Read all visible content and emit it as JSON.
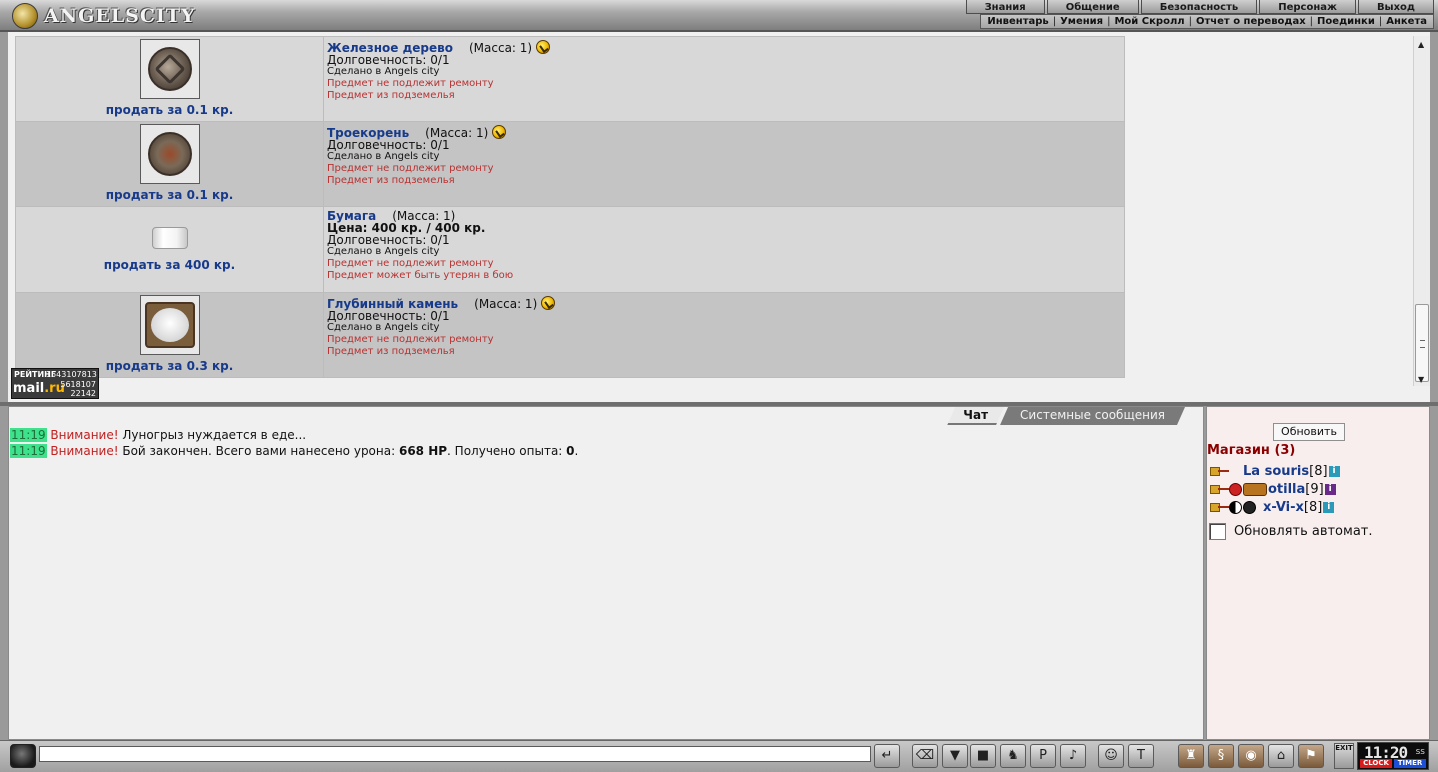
{
  "logo": {
    "text": "ANGELSCITY"
  },
  "top_nav": [
    "Знания",
    "Общение",
    "Безопасность",
    "Персонаж",
    "Выход"
  ],
  "sub_nav": [
    "Инвентарь",
    "Умения",
    "Мой Скролл",
    "Отчет о переводах",
    "Поединки",
    "Анкета"
  ],
  "items": [
    {
      "name": "Железное дерево",
      "mass": "(Масса: 1)",
      "gift": true,
      "sell": "продать за 0.1 кр.",
      "price": "",
      "durability": "Долговечность: 0/1",
      "made": "Сделано в Angels city",
      "red1": "Предмет не подлежит ремонту",
      "red2": "Предмет из подземелья",
      "image": "rune-disk-icon"
    },
    {
      "name": "Троекорень",
      "mass": "(Масса: 1)",
      "gift": true,
      "sell": "продать за 0.1 кр.",
      "price": "",
      "durability": "Долговечность: 0/1",
      "made": "Сделано в Angels city",
      "red1": "Предмет не подлежит ремонту",
      "red2": "Предмет из подземелья",
      "image": "spiral-disk-icon"
    },
    {
      "name": "Бумага",
      "mass": "(Масса: 1)",
      "gift": false,
      "sell": "продать за 400 кр.",
      "price": "Цена: 400 кр. / 400 кр.",
      "durability": "Долговечность: 0/1",
      "made": "Сделано в Angels city",
      "red1": "Предмет не подлежит ремонту",
      "red2": "Предмет может быть утерян в бою",
      "image": "paper-scroll-icon"
    },
    {
      "name": "Глубинный камень",
      "mass": "(Масса: 1)",
      "gift": true,
      "sell": "продать за 0.3 кр.",
      "price": "",
      "durability": "Долговечность: 0/1",
      "made": "Сделано в Angels city",
      "red1": "Предмет не подлежит ремонту",
      "red2": "Предмет из подземелья",
      "image": "deep-stone-icon"
    }
  ],
  "rating": {
    "label": "РЕЙТИНГ",
    "n1": "1543107813",
    "mail": "mail",
    "ru": ".ru",
    "n2": "5618107",
    "n3": "22142"
  },
  "chat": {
    "tabs": [
      "Чат",
      "Системные сообщения"
    ],
    "active_tab": "Чат",
    "messages": [
      {
        "time": "11:19",
        "warn": "Внимание!",
        "text": " Луногрыз нуждается в еде..."
      },
      {
        "time": "11:19",
        "warn": "Внимание!",
        "text_a": " Бой закончен. Всего вами нанесено урона: ",
        "bold_a": "668 HP",
        "text_b": ". Получено опыта: ",
        "bold_b": "0",
        "text_c": "."
      }
    ]
  },
  "side": {
    "refresh_label": "Обновить",
    "shop_title": "Магазин (3)",
    "users": [
      {
        "name": "La souris",
        "level": "[8]",
        "info": "i",
        "info_color": "#2a9ab8"
      },
      {
        "name": "otilla",
        "level": "[9]",
        "info": "i",
        "info_color": "#6a2a8a"
      },
      {
        "name": "x-Vi-x",
        "level": "[8]",
        "info": "i",
        "info_color": "#2a9ab8"
      }
    ],
    "auto_refresh_label": "Обновлять автомат.",
    "auto_refresh_checked": false
  },
  "bottom": {
    "input_value": "",
    "exit_label": "EXIT",
    "clock_time": "11:20",
    "clock_ss": "ss",
    "clock_label": "CLOCK",
    "timer_label": "TIMER"
  },
  "colors": {
    "link_blue": "#173a8a",
    "warn_red": "#c21f1f",
    "item_red": "#b83232",
    "time_green": "#3ee18c",
    "shop_title": "#8a0000"
  }
}
